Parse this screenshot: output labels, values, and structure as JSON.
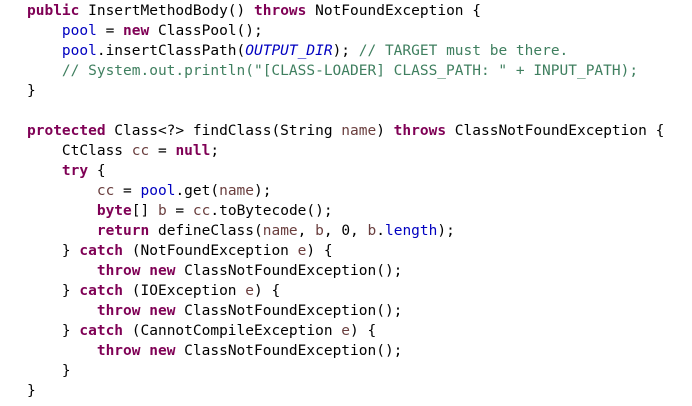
{
  "code": {
    "language": "java",
    "lines": [
      [
        [
          "kw",
          "public"
        ],
        [
          "pl",
          " InsertMethodBody() "
        ],
        [
          "kw",
          "throws"
        ],
        [
          "pl",
          " NotFoundException {"
        ]
      ],
      [
        [
          "pl",
          "    "
        ],
        [
          "fld",
          "pool"
        ],
        [
          "pl",
          " = "
        ],
        [
          "kw",
          "new"
        ],
        [
          "pl",
          " ClassPool();"
        ]
      ],
      [
        [
          "pl",
          "    "
        ],
        [
          "fld",
          "pool"
        ],
        [
          "pl",
          ".insertClassPath("
        ],
        [
          "sf",
          "OUTPUT_DIR"
        ],
        [
          "pl",
          "); "
        ],
        [
          "cm",
          "// TARGET must be there."
        ]
      ],
      [
        [
          "pl",
          "    "
        ],
        [
          "cm",
          "// System.out.println(\"[CLASS-LOADER] CLASS_PATH: \" + INPUT_PATH);"
        ]
      ],
      [
        [
          "pl",
          "}"
        ]
      ],
      [],
      [
        [
          "kw",
          "protected"
        ],
        [
          "pl",
          " Class<?> findClass(String "
        ],
        [
          "var",
          "name"
        ],
        [
          "pl",
          ") "
        ],
        [
          "kw",
          "throws"
        ],
        [
          "pl",
          " ClassNotFoundException {"
        ]
      ],
      [
        [
          "pl",
          "    CtClass "
        ],
        [
          "var",
          "cc"
        ],
        [
          "pl",
          " = "
        ],
        [
          "kw",
          "null"
        ],
        [
          "pl",
          ";"
        ]
      ],
      [
        [
          "pl",
          "    "
        ],
        [
          "kw",
          "try"
        ],
        [
          "pl",
          " {"
        ]
      ],
      [
        [
          "pl",
          "        "
        ],
        [
          "var",
          "cc"
        ],
        [
          "pl",
          " = "
        ],
        [
          "fld",
          "pool"
        ],
        [
          "pl",
          ".get("
        ],
        [
          "var",
          "name"
        ],
        [
          "pl",
          ");"
        ]
      ],
      [
        [
          "pl",
          "        "
        ],
        [
          "kw",
          "byte"
        ],
        [
          "pl",
          "[] "
        ],
        [
          "var",
          "b"
        ],
        [
          "pl",
          " = "
        ],
        [
          "var",
          "cc"
        ],
        [
          "pl",
          ".toBytecode();"
        ]
      ],
      [
        [
          "pl",
          "        "
        ],
        [
          "kw",
          "return"
        ],
        [
          "pl",
          " defineClass("
        ],
        [
          "var",
          "name"
        ],
        [
          "pl",
          ", "
        ],
        [
          "var",
          "b"
        ],
        [
          "pl",
          ", 0, "
        ],
        [
          "var",
          "b"
        ],
        [
          "pl",
          "."
        ],
        [
          "fld",
          "length"
        ],
        [
          "pl",
          ");"
        ]
      ],
      [
        [
          "pl",
          "    } "
        ],
        [
          "kw",
          "catch"
        ],
        [
          "pl",
          " (NotFoundException "
        ],
        [
          "var",
          "e"
        ],
        [
          "pl",
          ") {"
        ]
      ],
      [
        [
          "pl",
          "        "
        ],
        [
          "kw",
          "throw"
        ],
        [
          "pl",
          " "
        ],
        [
          "kw",
          "new"
        ],
        [
          "pl",
          " ClassNotFoundException();"
        ]
      ],
      [
        [
          "pl",
          "    } "
        ],
        [
          "kw",
          "catch"
        ],
        [
          "pl",
          " (IOException "
        ],
        [
          "var",
          "e"
        ],
        [
          "pl",
          ") {"
        ]
      ],
      [
        [
          "pl",
          "        "
        ],
        [
          "kw",
          "throw"
        ],
        [
          "pl",
          " "
        ],
        [
          "kw",
          "new"
        ],
        [
          "pl",
          " ClassNotFoundException();"
        ]
      ],
      [
        [
          "pl",
          "    } "
        ],
        [
          "kw",
          "catch"
        ],
        [
          "pl",
          " (CannotCompileException "
        ],
        [
          "var",
          "e"
        ],
        [
          "pl",
          ") {"
        ]
      ],
      [
        [
          "pl",
          "        "
        ],
        [
          "kw",
          "throw"
        ],
        [
          "pl",
          " "
        ],
        [
          "kw",
          "new"
        ],
        [
          "pl",
          " ClassNotFoundException();"
        ]
      ],
      [
        [
          "pl",
          "    }"
        ]
      ],
      [
        [
          "pl",
          "}"
        ]
      ]
    ]
  },
  "colors": {
    "keyword": "#7f0055",
    "field": "#0000c0",
    "static_field": "#0000c0",
    "comment": "#3f7f5f",
    "local_variable": "#6a3e3e",
    "plain": "#000000",
    "background": "#ffffff"
  }
}
